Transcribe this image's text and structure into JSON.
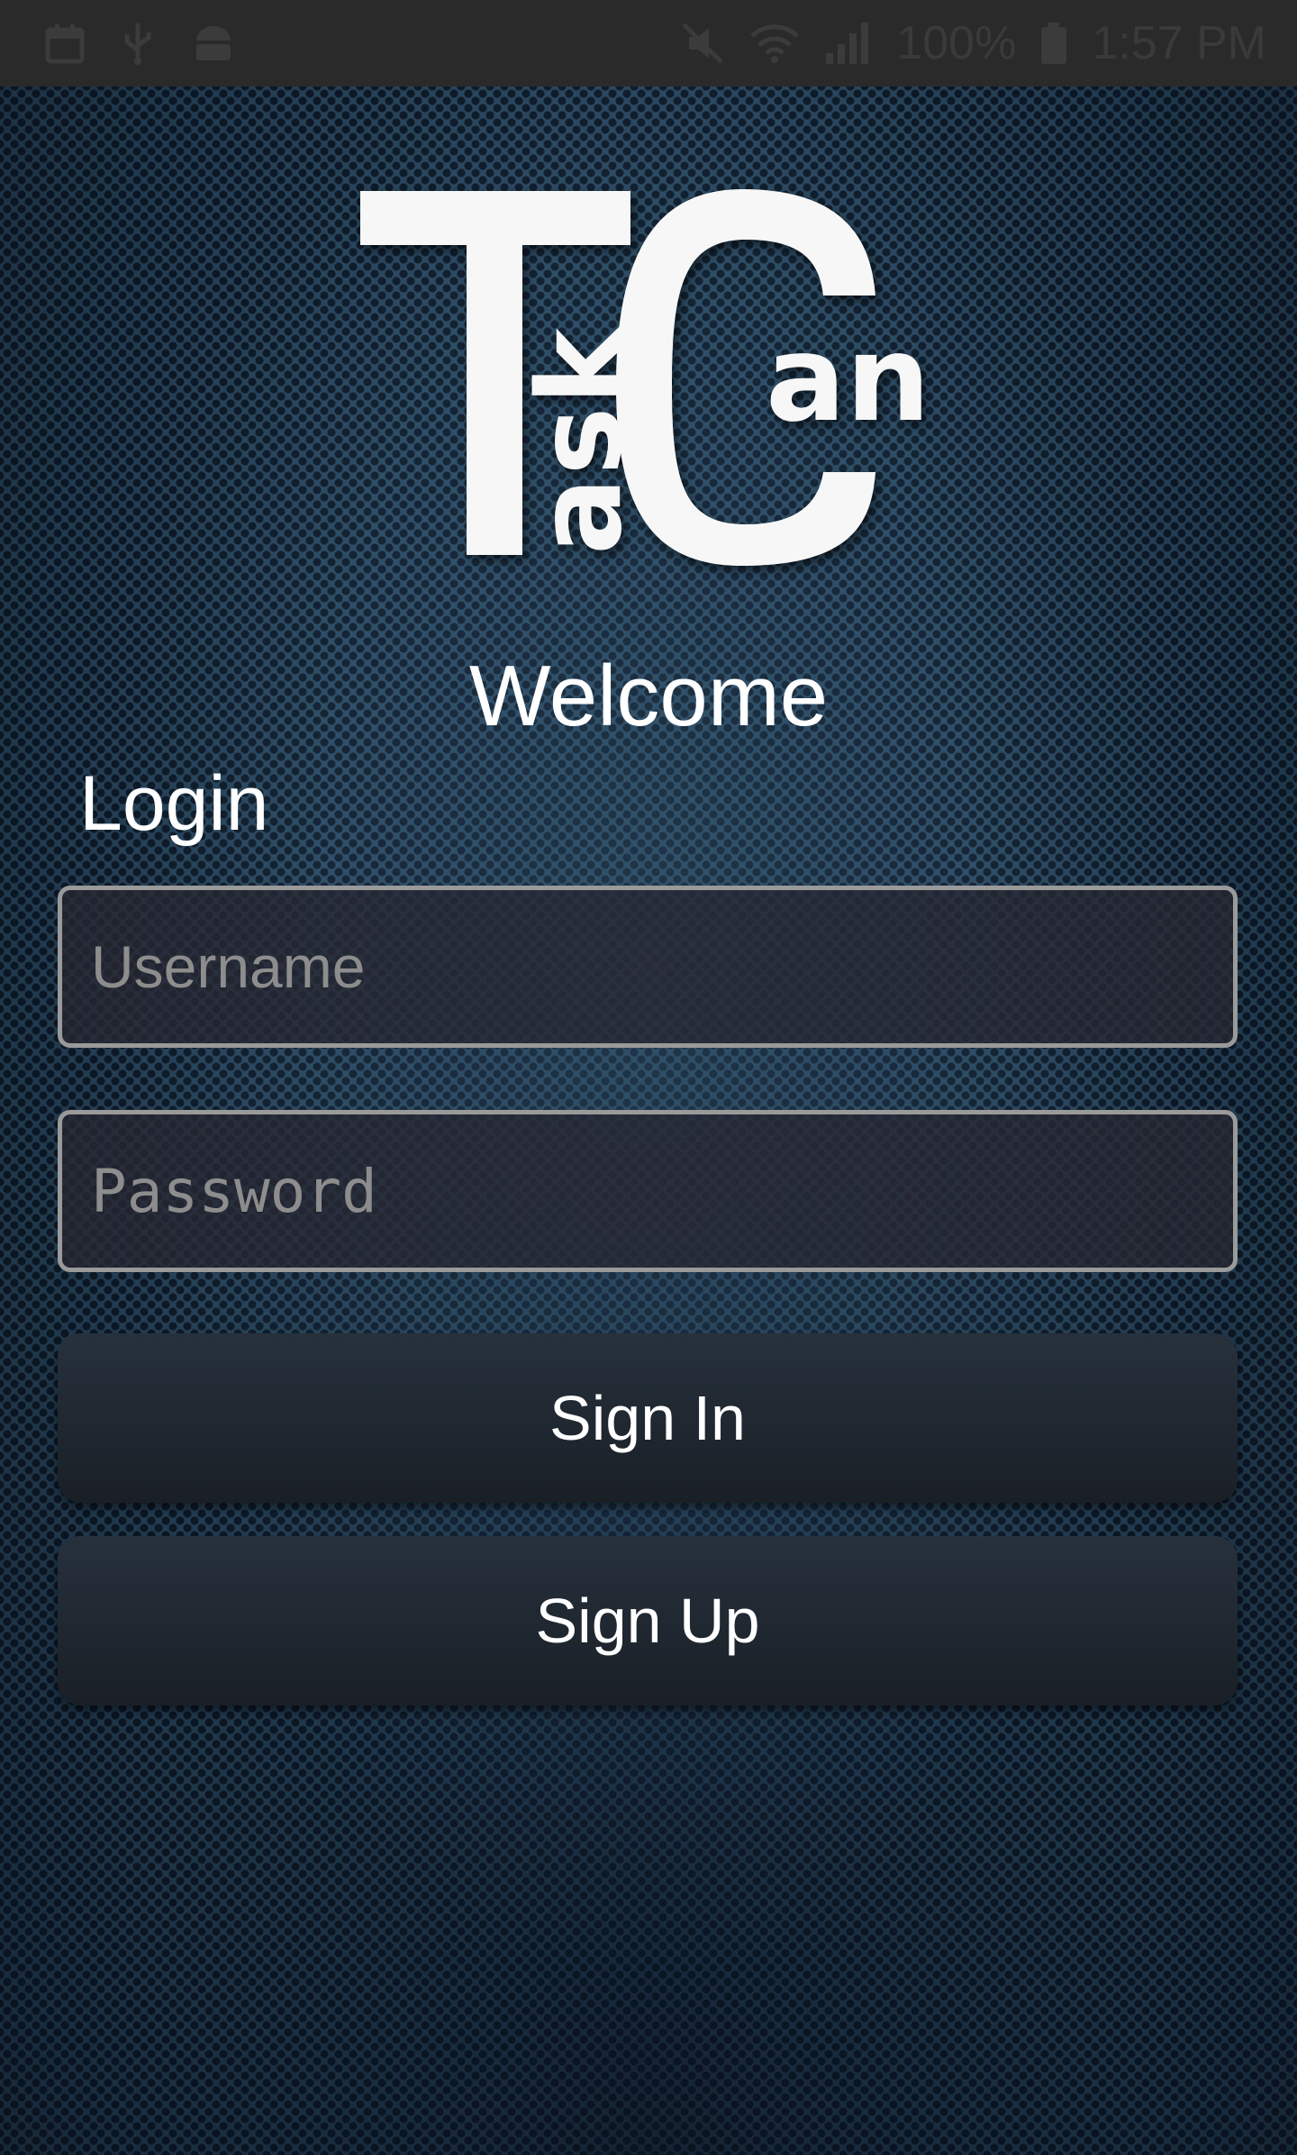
{
  "status_bar": {
    "left_icons": [
      "calendar-icon",
      "usb-icon",
      "android-debug-icon"
    ],
    "right_icons": [
      "mute-icon",
      "wifi-icon",
      "signal-icon"
    ],
    "battery_text": "100%",
    "battery_icon": "battery-icon",
    "time": "1:57 PM"
  },
  "logo": {
    "big_letter_1": "T",
    "vertical_text": "ask",
    "big_letter_2": "C",
    "side_text": "an",
    "color": "#f7f7f7"
  },
  "welcome": "Welcome",
  "login_label": "Login",
  "username": {
    "placeholder": "Username",
    "value": ""
  },
  "password": {
    "placeholder": "Password",
    "value": ""
  },
  "buttons": {
    "sign_in": "Sign In",
    "sign_up": "Sign Up"
  },
  "colors": {
    "background": "#2c4a62",
    "button": "#1f2730",
    "field_border": "#9a9a9a",
    "status_bar": "#2a2a2a"
  }
}
